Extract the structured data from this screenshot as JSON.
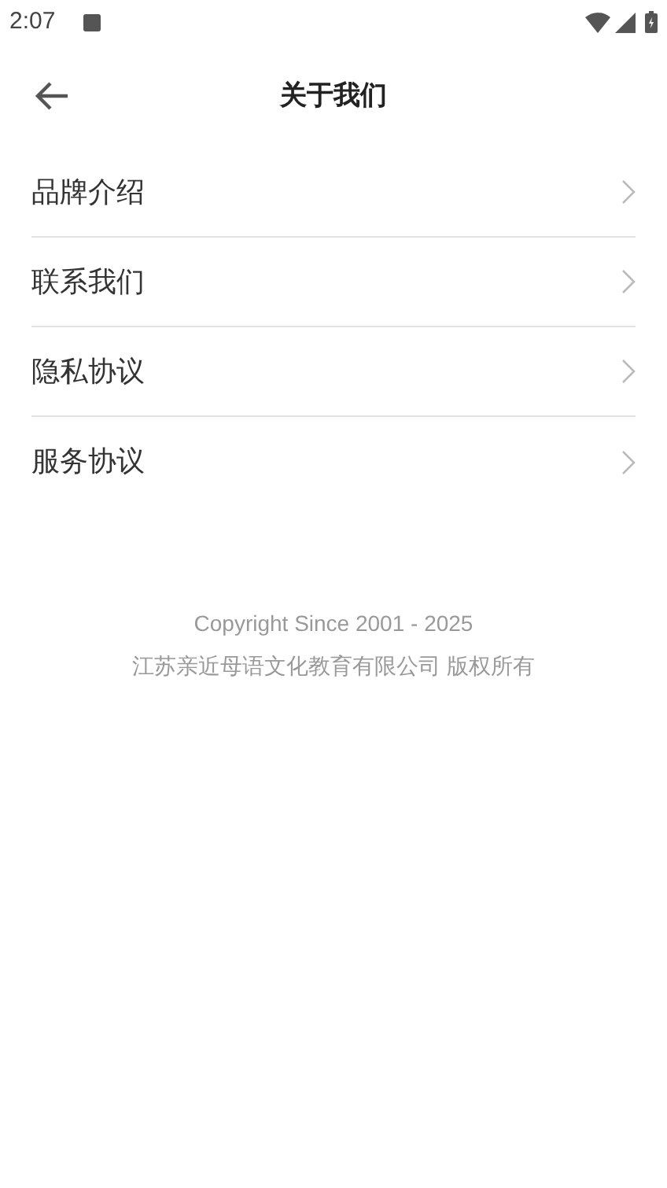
{
  "status_bar": {
    "time": "2:07"
  },
  "header": {
    "title": "关于我们"
  },
  "menu": [
    {
      "label": "品牌介绍"
    },
    {
      "label": "联系我们"
    },
    {
      "label": "隐私协议"
    },
    {
      "label": "服务协议"
    }
  ],
  "footer": {
    "copyright": "Copyright Since 2001 - 2025",
    "company": "江苏亲近母语文化教育有限公司 版权所有"
  }
}
